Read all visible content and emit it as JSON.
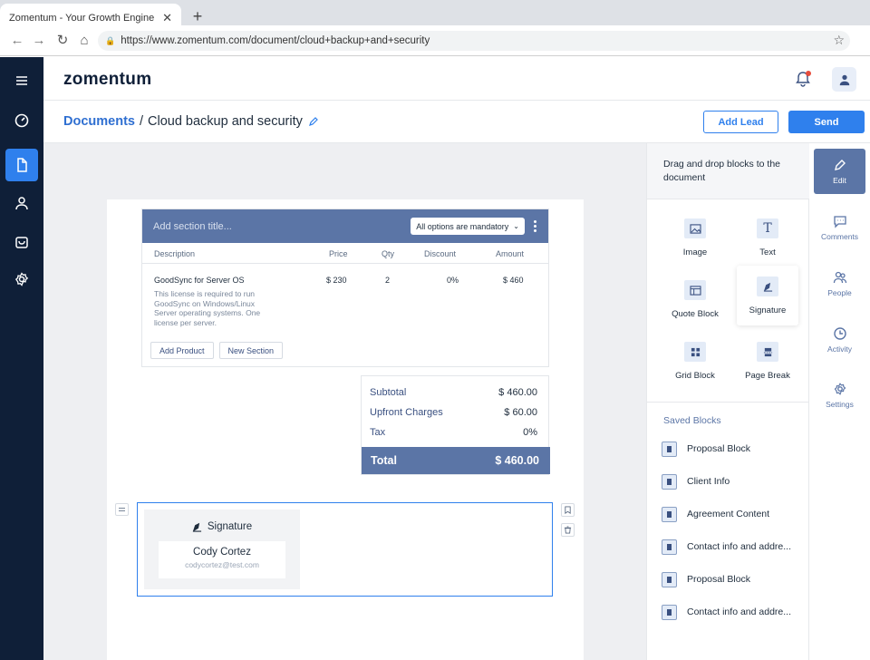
{
  "browser": {
    "tab_title": "Zomentum - Your Growth Engine",
    "tab_close": "✕",
    "new_tab": "+",
    "url": "https://www.zomentum.com/document/cloud+backup+and+security"
  },
  "header": {
    "logo": "zomentum"
  },
  "breadcrumb": {
    "root": "Documents",
    "separator": "/",
    "current": "Cloud backup and security"
  },
  "actions": {
    "add_lead": "Add Lead",
    "send": "Send"
  },
  "pricing_table": {
    "title_placeholder": "Add section title...",
    "options_select": "All options are mandatory",
    "columns": {
      "description": "Description",
      "price": "Price",
      "qty": "Qty",
      "discount": "Discount",
      "amount": "Amount"
    },
    "row": {
      "name": "GoodSync for Server OS",
      "description": "This license is required to run GoodSync on Windows/Linux Server operating systems. One license per server.",
      "price": "$ 230",
      "qty": "2",
      "discount": "0%",
      "amount": "$ 460"
    },
    "add_product": "Add Product",
    "new_section": "New Section"
  },
  "totals": {
    "subtotal_label": "Subtotal",
    "subtotal_value": "$ 460.00",
    "upfront_label": "Upfront Charges",
    "upfront_value": "$ 60.00",
    "tax_label": "Tax",
    "tax_value": "0%",
    "total_label": "Total",
    "total_value": "$ 460.00"
  },
  "signature": {
    "heading": "Signature",
    "name": "Cody Cortez",
    "email": "codycortez@test.com"
  },
  "blocks_panel": {
    "hint": "Drag and drop blocks to the document",
    "tiles": {
      "image": "Image",
      "text": "Text",
      "quote": "Quote Block",
      "signature": "Signature",
      "grid": "Grid Block",
      "page_break": "Page Break"
    },
    "saved_title": "Saved Blocks",
    "saved": [
      "Proposal Block",
      "Client Info",
      "Agreement Content",
      "Contact info and addre...",
      "Proposal Block",
      "Contact info and addre..."
    ]
  },
  "tools": {
    "edit": "Edit",
    "comments": "Comments",
    "people": "People",
    "activity": "Activity",
    "settings": "Settings"
  },
  "colors": {
    "primary": "#2f80ed",
    "rail": "#0f1f38",
    "table_header": "#5b75a6"
  }
}
